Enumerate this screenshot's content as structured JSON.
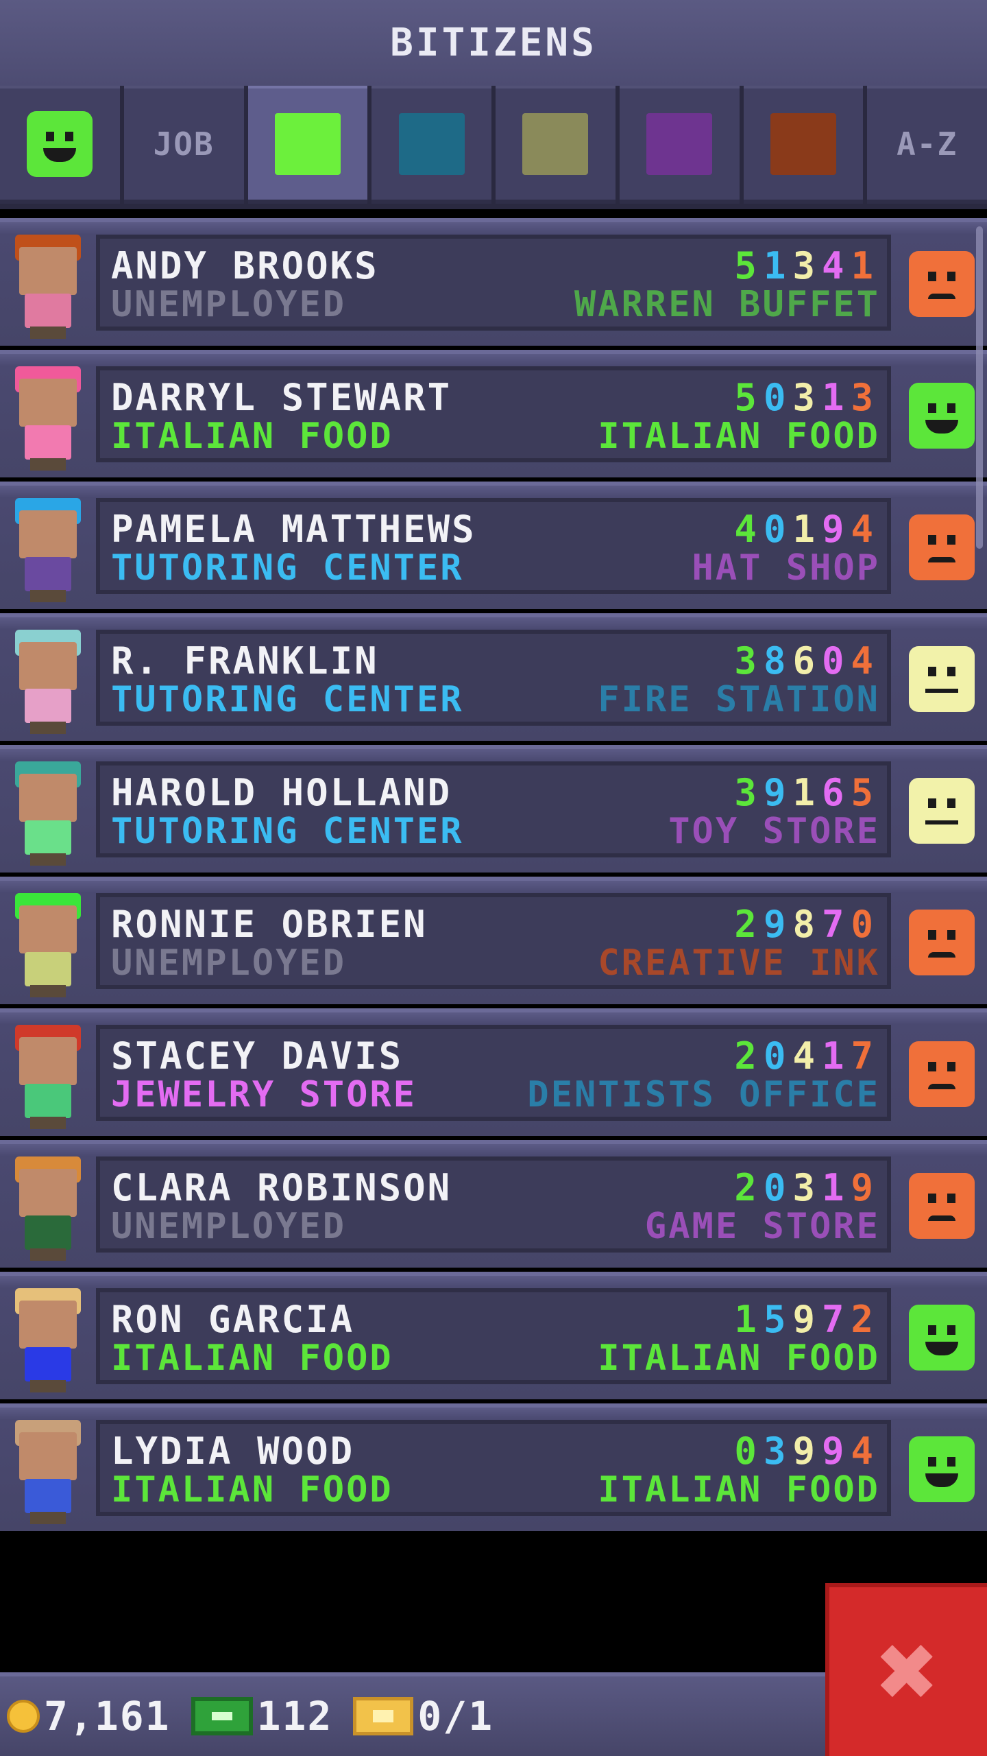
{
  "header": {
    "title": "BITIZENS"
  },
  "tabs": [
    {
      "kind": "face",
      "mood": "happy"
    },
    {
      "kind": "text",
      "label": "JOB"
    },
    {
      "kind": "swatch",
      "color": "#6cf03c",
      "active": true
    },
    {
      "kind": "swatch",
      "color": "#1e6a87"
    },
    {
      "kind": "swatch",
      "color": "#8a8a5a"
    },
    {
      "kind": "swatch",
      "color": "#6e3490"
    },
    {
      "kind": "swatch",
      "color": "#8a3a1a"
    },
    {
      "kind": "text",
      "label": "A-Z"
    }
  ],
  "digit_colors": [
    "#5ce63a",
    "#3bbcf2",
    "#f2eeaa",
    "#e36cf2",
    "#f0703a"
  ],
  "bitizens": [
    {
      "name": "ANDY BROOKS",
      "job": "UNEMPLOYED",
      "job_color": "#7a7990",
      "score": "51341",
      "dream": "WARREN BUFFET",
      "dream_color": "#4fa84a",
      "mood": "sad",
      "hair": "#c0501a",
      "shirt": "#e07aa0"
    },
    {
      "name": "DARRYL STEWART",
      "job": "ITALIAN FOOD",
      "job_color": "#5ce63a",
      "score": "50313",
      "dream": "ITALIAN FOOD",
      "dream_color": "#5ce63a",
      "mood": "happy",
      "hair": "#f05a9a",
      "shirt": "#f27ab0"
    },
    {
      "name": "PAMELA MATTHEWS",
      "job": "TUTORING CENTER",
      "job_color": "#3bbcf2",
      "score": "40194",
      "dream": "HAT SHOP",
      "dream_color": "#9a4fb8",
      "mood": "sad",
      "hair": "#2aa6e6",
      "shirt": "#6a4aa0"
    },
    {
      "name": "R. FRANKLIN",
      "job": "TUTORING CENTER",
      "job_color": "#3bbcf2",
      "score": "38604",
      "dream": "FIRE STATION",
      "dream_color": "#2a7ea8",
      "mood": "neutral",
      "hair": "#8ad0d0",
      "shirt": "#e6a0c8"
    },
    {
      "name": "HAROLD HOLLAND",
      "job": "TUTORING CENTER",
      "job_color": "#3bbcf2",
      "score": "39165",
      "dream": "TOY STORE",
      "dream_color": "#9a4fb8",
      "mood": "neutral",
      "hair": "#3aa89a",
      "shirt": "#6ae08a"
    },
    {
      "name": "RONNIE OBRIEN",
      "job": "UNEMPLOYED",
      "job_color": "#7a7990",
      "score": "29870",
      "dream": "CREATIVE INK",
      "dream_color": "#a8482a",
      "mood": "sad",
      "hair": "#3ae63a",
      "shirt": "#c8d07a"
    },
    {
      "name": "STACEY DAVIS",
      "job": "JEWELRY STORE",
      "job_color": "#e36cf2",
      "score": "20417",
      "dream": "DENTISTS OFFICE",
      "dream_color": "#2a7ea8",
      "mood": "sad",
      "hair": "#d03a2a",
      "shirt": "#4ac87a"
    },
    {
      "name": "CLARA ROBINSON",
      "job": "UNEMPLOYED",
      "job_color": "#7a7990",
      "score": "20319",
      "dream": "GAME STORE",
      "dream_color": "#9a4fb8",
      "mood": "sad",
      "hair": "#d88a3a",
      "shirt": "#2a6a3a"
    },
    {
      "name": "RON GARCIA",
      "job": "ITALIAN FOOD",
      "job_color": "#5ce63a",
      "score": "15972",
      "dream": "ITALIAN FOOD",
      "dream_color": "#5ce63a",
      "mood": "happy",
      "hair": "#e6c07a",
      "shirt": "#2a3ae6"
    },
    {
      "name": "LYDIA WOOD",
      "job": "ITALIAN FOOD",
      "job_color": "#5ce63a",
      "score": "03994",
      "dream": "ITALIAN FOOD",
      "dream_color": "#5ce63a",
      "mood": "happy",
      "hair": "#c8a07a",
      "shirt": "#3a5ad8"
    }
  ],
  "mood_colors": {
    "happy": "#5ce63a",
    "sad": "#f0703a",
    "neutral": "#f2f2aa"
  },
  "footer": {
    "coins": "7,161",
    "bux": "112",
    "tickets": "0/1",
    "coin_icon": "coin-icon",
    "bux_icon": "bux-icon",
    "ticket_icon": "ticket-icon"
  },
  "close_button": {
    "icon": "close-icon",
    "glyph": "✖"
  }
}
